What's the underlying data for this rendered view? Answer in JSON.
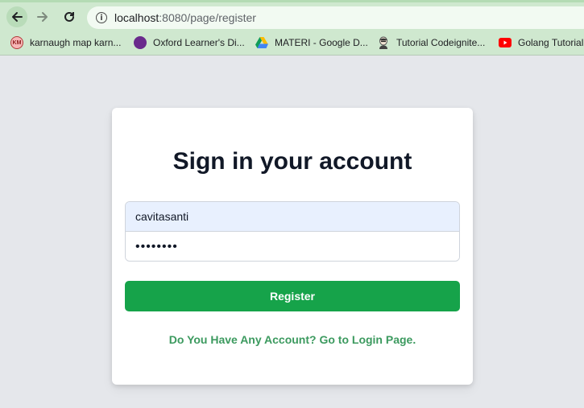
{
  "browser": {
    "url_host": "localhost",
    "url_rest": ":8080/page/register",
    "bookmarks": [
      {
        "label": "karnaugh map karn...",
        "icon": "karnaugh-map-icon"
      },
      {
        "label": "Oxford Learner's Di...",
        "icon": "oxford-icon"
      },
      {
        "label": "MATERI - Google D...",
        "icon": "google-drive-icon"
      },
      {
        "label": "Tutorial Codeignite...",
        "icon": "person-avatar-icon"
      },
      {
        "label": "Golang Tutorial",
        "icon": "youtube-icon"
      }
    ],
    "km_icon_text": "KM"
  },
  "form": {
    "title": "Sign in your account",
    "username_value": "cavitasanti",
    "password_value": "passwor1",
    "register_label": "Register",
    "login_link_label": "Do You Have Any Account? Go to Login Page."
  },
  "colors": {
    "primary": "#16a34a",
    "link": "#3c9a5f",
    "background": "#e5e7eb",
    "browser_chrome": "#cfe8cf"
  }
}
